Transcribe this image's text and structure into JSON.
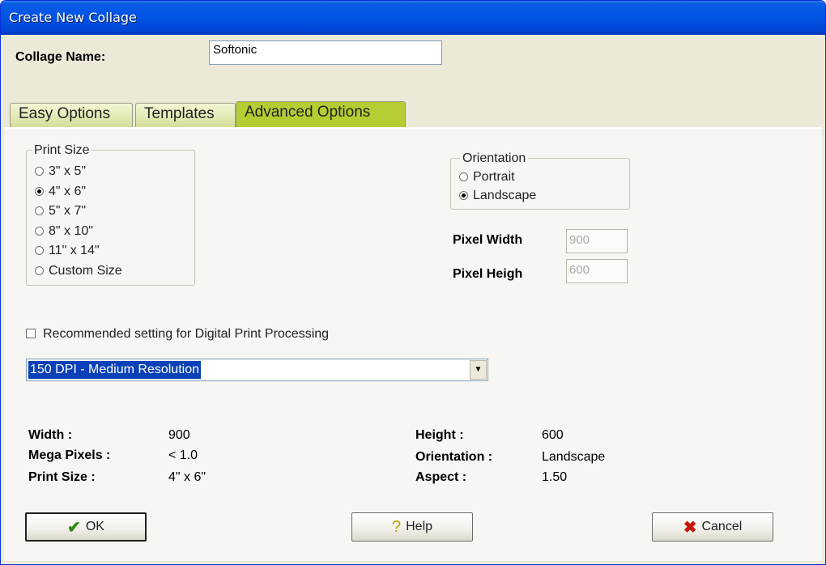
{
  "window": {
    "title": "Create New Collage"
  },
  "collage_name": {
    "label": "Collage Name:",
    "value": "Softonic"
  },
  "tabs": [
    {
      "label": "Easy Options",
      "active": false
    },
    {
      "label": "Templates",
      "active": false
    },
    {
      "label": "Advanced Options",
      "active": true
    }
  ],
  "print_size": {
    "legend": "Print Size",
    "options": [
      "3\" x 5\"",
      "4\" x 6\"",
      "5\" x 7\"",
      "8\" x 10\"",
      "11\" x 14\"",
      "Custom Size"
    ],
    "selected": "4\" x 6\""
  },
  "orientation": {
    "legend": "Orientation",
    "options": [
      "Portrait",
      "Landscape"
    ],
    "selected": "Landscape"
  },
  "pixel_width": {
    "label": "Pixel Width",
    "value": "900"
  },
  "pixel_height": {
    "label": "Pixel Heigh",
    "value": "600"
  },
  "recommended": {
    "label": "Recommended setting for Digital Print Processing",
    "checked": false
  },
  "resolution": {
    "selected": "150 DPI - Medium Resolution"
  },
  "summary": {
    "width_label": "Width :",
    "width_value": "900",
    "megapixels_label": "Mega Pixels :",
    "megapixels_value": "< 1.0",
    "printsize_label": "Print Size :",
    "printsize_value": "4\" x 6\"",
    "height_label": "Height :",
    "height_value": "600",
    "orientation_label": "Orientation :",
    "orientation_value": "Landscape",
    "aspect_label": "Aspect :",
    "aspect_value": "1.50"
  },
  "buttons": {
    "ok": "OK",
    "help": "Help",
    "cancel": "Cancel"
  },
  "colors": {
    "active_tab": "#b7cc33",
    "titlebar": "#0055e6",
    "selection": "#0a40b8"
  }
}
